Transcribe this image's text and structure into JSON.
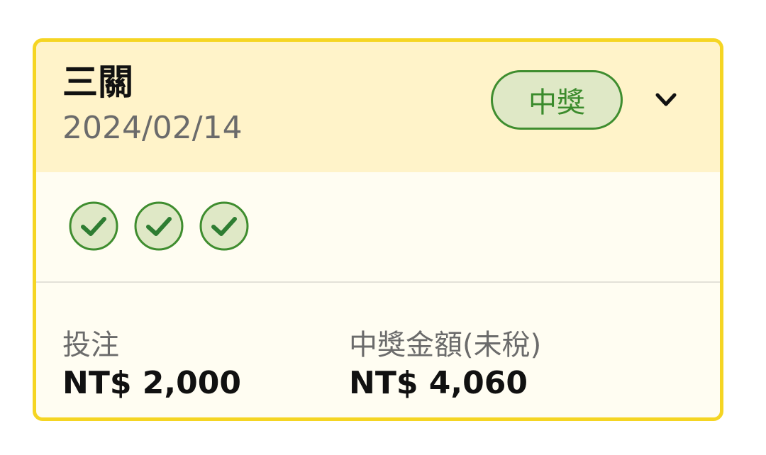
{
  "card": {
    "title": "三關",
    "date": "2024/02/14",
    "status_badge": "中獎",
    "expand_icon": "chevron-down-icon",
    "legs": [
      {
        "status": "won",
        "icon": "check-circle-icon"
      },
      {
        "status": "won",
        "icon": "check-circle-icon"
      },
      {
        "status": "won",
        "icon": "check-circle-icon"
      }
    ],
    "bet_label": "投注",
    "bet_value": "NT$ 2,000",
    "prize_label": "中獎金額(未稅)",
    "prize_value": "NT$ 4,060"
  },
  "colors": {
    "border": "#f5d523",
    "header_bg": "#fff3c9",
    "body_bg": "#fffdf2",
    "win_green": "#3f8d2f",
    "win_fill": "#dfe8c6"
  }
}
